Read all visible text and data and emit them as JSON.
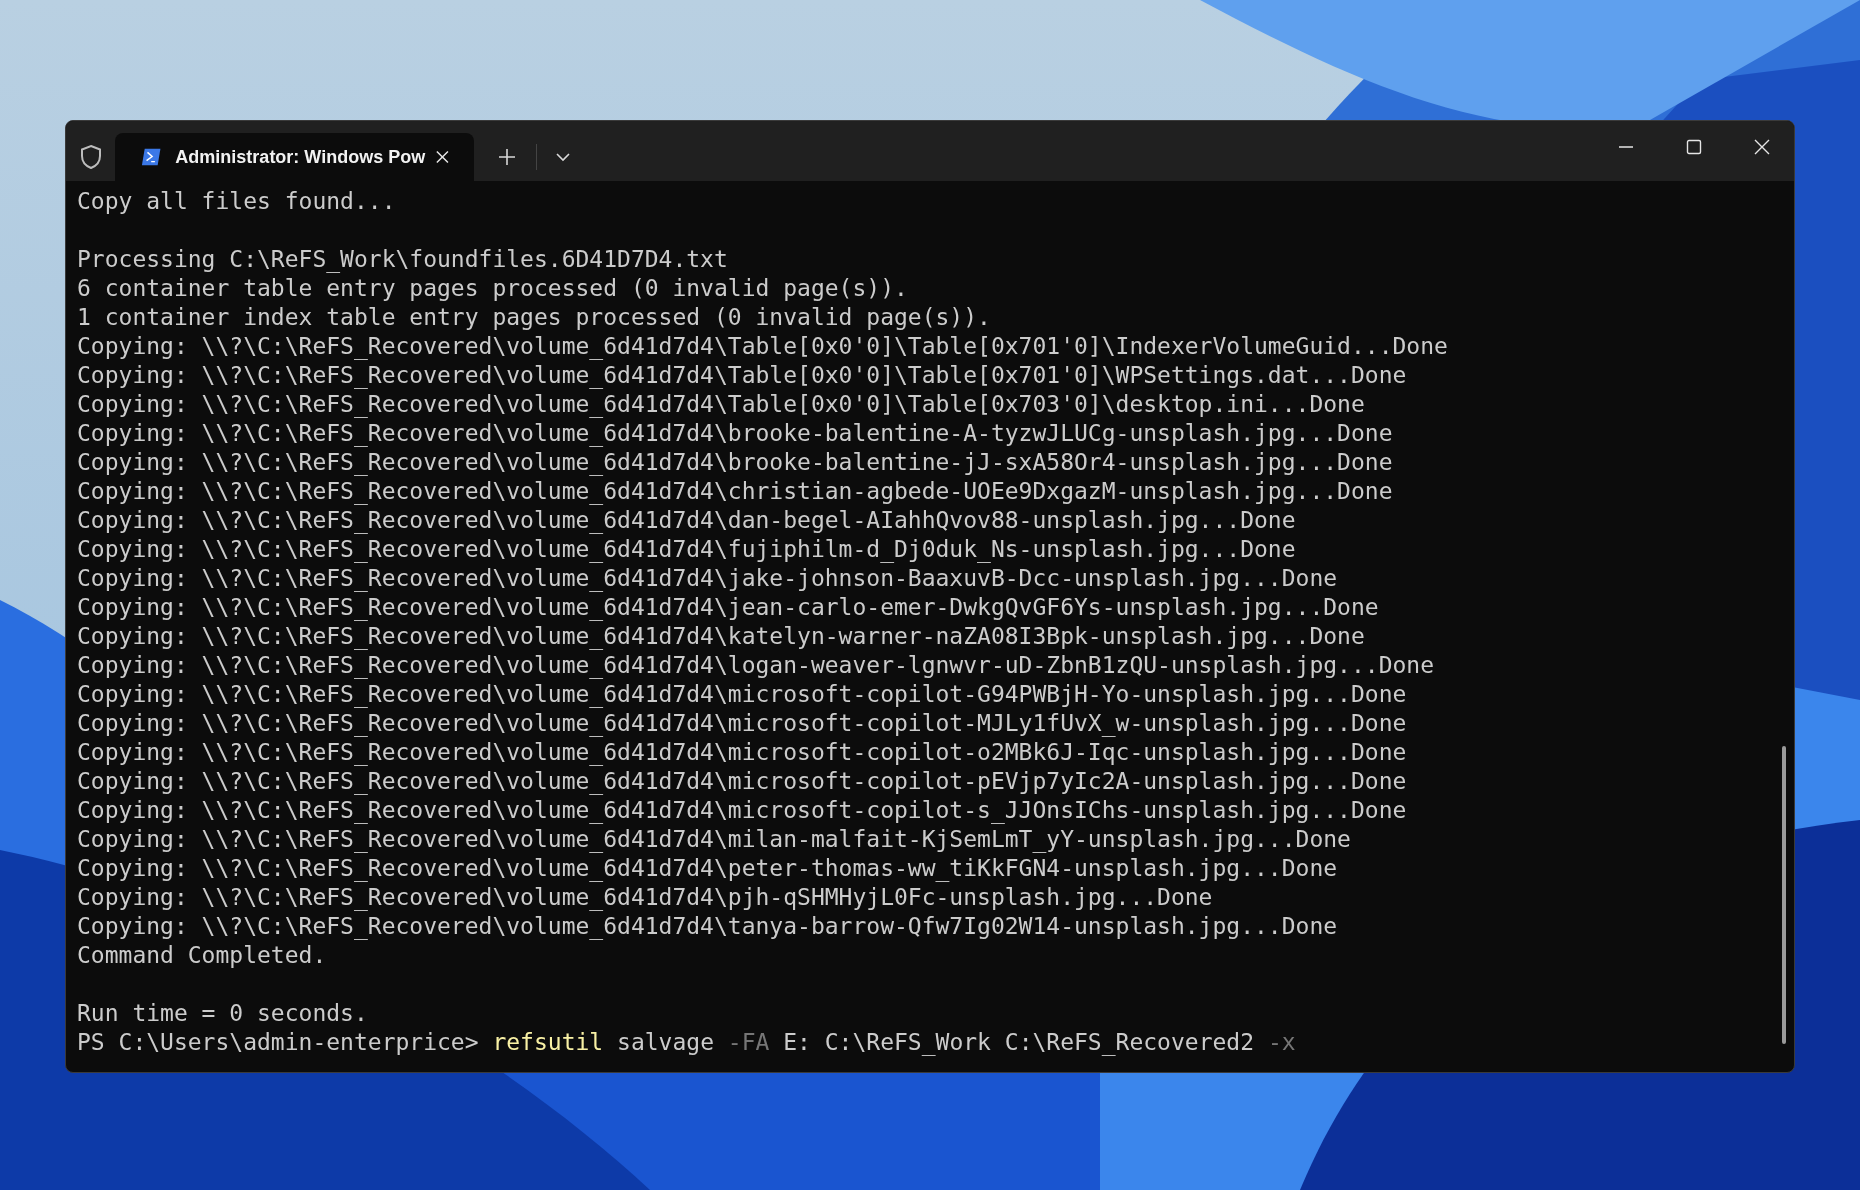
{
  "tabs": [
    {
      "title": "Administrator: Windows Pow",
      "selected": true
    }
  ],
  "output_blocks": [
    [
      "Copy all files found..."
    ],
    [
      "Processing C:\\ReFS_Work\\foundfiles.6D41D7D4.txt",
      "6 container table entry pages processed (0 invalid page(s)).",
      "1 container index table entry pages processed (0 invalid page(s)).",
      "Copying: \\\\?\\C:\\ReFS_Recovered\\volume_6d41d7d4\\Table[0x0'0]\\Table[0x701'0]\\IndexerVolumeGuid...Done",
      "Copying: \\\\?\\C:\\ReFS_Recovered\\volume_6d41d7d4\\Table[0x0'0]\\Table[0x701'0]\\WPSettings.dat...Done",
      "Copying: \\\\?\\C:\\ReFS_Recovered\\volume_6d41d7d4\\Table[0x0'0]\\Table[0x703'0]\\desktop.ini...Done",
      "Copying: \\\\?\\C:\\ReFS_Recovered\\volume_6d41d7d4\\brooke-balentine-A-tyzwJLUCg-unsplash.jpg...Done",
      "Copying: \\\\?\\C:\\ReFS_Recovered\\volume_6d41d7d4\\brooke-balentine-jJ-sxA58Or4-unsplash.jpg...Done",
      "Copying: \\\\?\\C:\\ReFS_Recovered\\volume_6d41d7d4\\christian-agbede-UOEe9DxgazM-unsplash.jpg...Done",
      "Copying: \\\\?\\C:\\ReFS_Recovered\\volume_6d41d7d4\\dan-begel-AIahhQvov88-unsplash.jpg...Done",
      "Copying: \\\\?\\C:\\ReFS_Recovered\\volume_6d41d7d4\\fujiphilm-d_Dj0duk_Ns-unsplash.jpg...Done",
      "Copying: \\\\?\\C:\\ReFS_Recovered\\volume_6d41d7d4\\jake-johnson-BaaxuvB-Dcc-unsplash.jpg...Done",
      "Copying: \\\\?\\C:\\ReFS_Recovered\\volume_6d41d7d4\\jean-carlo-emer-DwkgQvGF6Ys-unsplash.jpg...Done",
      "Copying: \\\\?\\C:\\ReFS_Recovered\\volume_6d41d7d4\\katelyn-warner-naZA08I3Bpk-unsplash.jpg...Done",
      "Copying: \\\\?\\C:\\ReFS_Recovered\\volume_6d41d7d4\\logan-weaver-lgnwvr-uD-ZbnB1zQU-unsplash.jpg...Done",
      "Copying: \\\\?\\C:\\ReFS_Recovered\\volume_6d41d7d4\\microsoft-copilot-G94PWBjH-Yo-unsplash.jpg...Done",
      "Copying: \\\\?\\C:\\ReFS_Recovered\\volume_6d41d7d4\\microsoft-copilot-MJLy1fUvX_w-unsplash.jpg...Done",
      "Copying: \\\\?\\C:\\ReFS_Recovered\\volume_6d41d7d4\\microsoft-copilot-o2MBk6J-Iqc-unsplash.jpg...Done",
      "Copying: \\\\?\\C:\\ReFS_Recovered\\volume_6d41d7d4\\microsoft-copilot-pEVjp7yIc2A-unsplash.jpg...Done",
      "Copying: \\\\?\\C:\\ReFS_Recovered\\volume_6d41d7d4\\microsoft-copilot-s_JJOnsIChs-unsplash.jpg...Done",
      "Copying: \\\\?\\C:\\ReFS_Recovered\\volume_6d41d7d4\\milan-malfait-KjSemLmT_yY-unsplash.jpg...Done",
      "Copying: \\\\?\\C:\\ReFS_Recovered\\volume_6d41d7d4\\peter-thomas-ww_tiKkFGN4-unsplash.jpg...Done",
      "Copying: \\\\?\\C:\\ReFS_Recovered\\volume_6d41d7d4\\pjh-qSHMHyjL0Fc-unsplash.jpg...Done",
      "Copying: \\\\?\\C:\\ReFS_Recovered\\volume_6d41d7d4\\tanya-barrow-Qfw7Ig02W14-unsplash.jpg...Done",
      "Command Completed."
    ],
    [
      "Run time = 0 seconds."
    ]
  ],
  "prompt": {
    "prefix": "PS C:\\Users\\admin-enterprice>",
    "tokens": [
      {
        "text": "refsutil",
        "kind": "command"
      },
      {
        "text": "salvage",
        "kind": "argument"
      },
      {
        "text": "-FA",
        "kind": "parameter"
      },
      {
        "text": "E:",
        "kind": "argument"
      },
      {
        "text": "C:\\ReFS_Work",
        "kind": "argument"
      },
      {
        "text": "C:\\ReFS_Recovered2",
        "kind": "argument"
      },
      {
        "text": "-x",
        "kind": "parameter"
      }
    ]
  }
}
